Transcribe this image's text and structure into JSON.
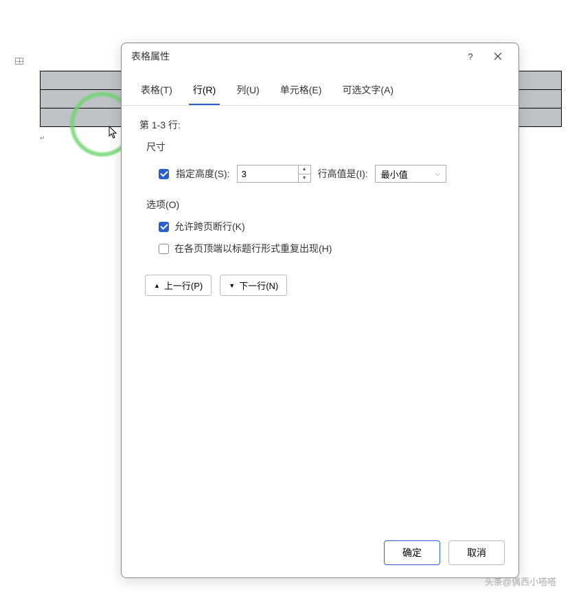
{
  "dialog": {
    "title": "表格属性",
    "help": "?",
    "tabs": {
      "table": "表格(T)",
      "row": "行(R)",
      "column": "列(U)",
      "cell": "单元格(E)",
      "alt": "可选文字(A)"
    },
    "row_info": "第 1-3 行:",
    "size_label": "尺寸",
    "specify_height": "指定高度(S):",
    "height_value": "3",
    "row_height_is": "行高值是(I):",
    "row_height_type": "最小值",
    "options_label": "选项(O)",
    "allow_break": "允许跨页断行(K)",
    "repeat_header": "在各页顶端以标题行形式重复出现(H)",
    "prev_row": "上一行(P)",
    "next_row": "下一行(N)",
    "ok": "确定",
    "cancel": "取消"
  },
  "watermark": "头条@偶西小嗒嗒"
}
